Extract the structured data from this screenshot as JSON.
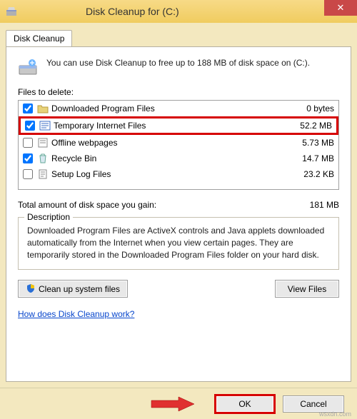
{
  "window": {
    "title": "Disk Cleanup for  (C:)",
    "close": "✕"
  },
  "tab": {
    "label": "Disk Cleanup"
  },
  "intro": {
    "text": "You can use Disk Cleanup to free up to 188 MB of disk space on  (C:)."
  },
  "files_label": "Files to delete:",
  "files": [
    {
      "checked": true,
      "icon": "folder-dl",
      "name": "Downloaded Program Files",
      "size": "0 bytes"
    },
    {
      "checked": true,
      "icon": "ie-temp",
      "name": "Temporary Internet Files",
      "size": "52.2 MB"
    },
    {
      "checked": false,
      "icon": "offline",
      "name": "Offline webpages",
      "size": "5.73 MB"
    },
    {
      "checked": true,
      "icon": "recycle",
      "name": "Recycle Bin",
      "size": "14.7 MB"
    },
    {
      "checked": false,
      "icon": "setup",
      "name": "Setup Log Files",
      "size": "23.2 KB"
    }
  ],
  "total": {
    "label": "Total amount of disk space you gain:",
    "value": "181 MB"
  },
  "description": {
    "legend": "Description",
    "text": "Downloaded Program Files are ActiveX controls and Java applets downloaded automatically from the Internet when you view certain pages. They are temporarily stored in the Downloaded Program Files folder on your hard disk."
  },
  "buttons": {
    "cleanup": "Clean up system files",
    "view": "View Files",
    "ok": "OK",
    "cancel": "Cancel"
  },
  "link": "How does Disk Cleanup work?",
  "watermark": "wsxdn.com"
}
